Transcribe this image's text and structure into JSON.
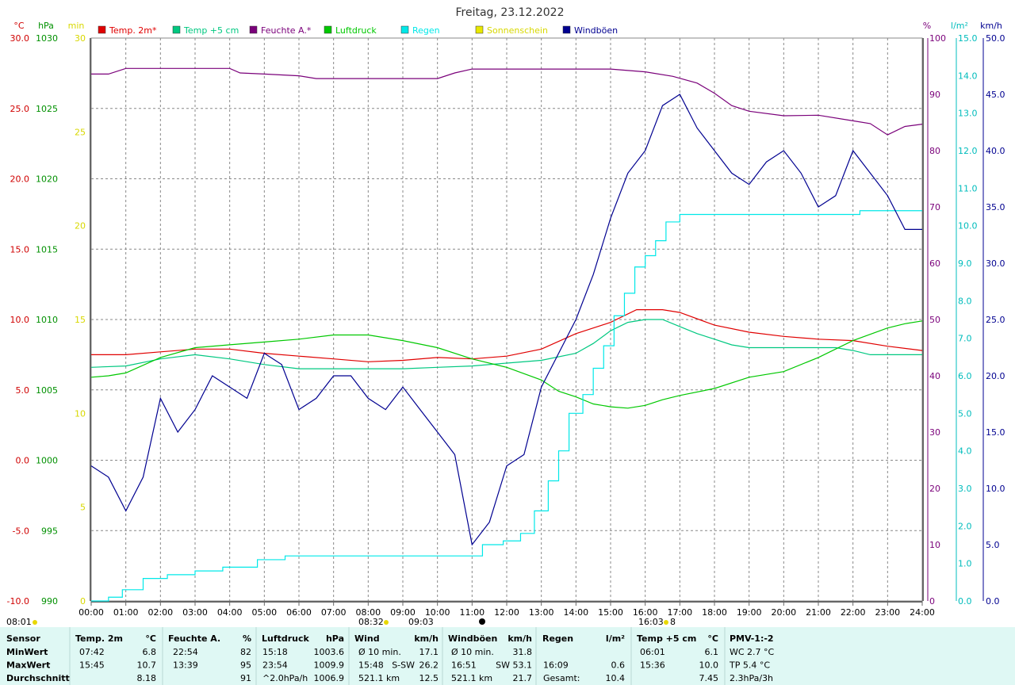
{
  "title": "Freitag, 23.12.2022",
  "legend": [
    {
      "label": "Temp. 2m*",
      "color": "#e00000"
    },
    {
      "label": "Temp +5 cm",
      "color": "#00c880"
    },
    {
      "label": "Feuchte A.*",
      "color": "#7a007a"
    },
    {
      "label": "Luftdruck",
      "color": "#00c800"
    },
    {
      "label": "Regen",
      "color": "#00e8e8"
    },
    {
      "label": "Sonnenschein",
      "color": "#e8e800"
    },
    {
      "label": "Windböen",
      "color": "#000090"
    }
  ],
  "axes": {
    "temp": {
      "unit": "°C",
      "ticks": [
        "30.0",
        "25.0",
        "20.0",
        "15.0",
        "10.0",
        "5.0",
        "0.0",
        "-5.0",
        "-10.0"
      ],
      "range": [
        -10,
        30
      ]
    },
    "pressure": {
      "unit": "hPa",
      "ticks": [
        "1030",
        "1025",
        "1020",
        "1015",
        "1010",
        "1005",
        "1000",
        "995",
        "990"
      ],
      "range": [
        990,
        1030
      ]
    },
    "sun": {
      "unit": "min",
      "ticks": [
        "30",
        "25",
        "20",
        "15",
        "10",
        "5",
        "0"
      ],
      "range": [
        0,
        30
      ]
    },
    "humidity": {
      "unit": "%",
      "ticks": [
        "100",
        "90",
        "80",
        "70",
        "60",
        "50",
        "40",
        "30",
        "20",
        "10",
        "0"
      ],
      "range": [
        0,
        100
      ]
    },
    "rain": {
      "unit": "l/m²",
      "ticks": [
        "15.0",
        "14.0",
        "13.0",
        "12.0",
        "11.0",
        "10.0",
        "9.0",
        "8.0",
        "7.0",
        "6.0",
        "5.0",
        "4.0",
        "3.0",
        "2.0",
        "1.0",
        "0.0"
      ],
      "range": [
        0,
        15
      ]
    },
    "wind": {
      "unit": "km/h",
      "ticks": [
        "50.0",
        "45.0",
        "40.0",
        "35.0",
        "30.0",
        "25.0",
        "20.0",
        "15.0",
        "10.0",
        "5.0",
        "0.0"
      ],
      "range": [
        0,
        50
      ]
    },
    "time": {
      "ticks": [
        "00:00",
        "01:00",
        "02:00",
        "03:00",
        "04:00",
        "05:00",
        "06:00",
        "07:00",
        "08:00",
        "09:00",
        "10:00",
        "11:00",
        "12:00",
        "13:00",
        "14:00",
        "15:00",
        "16:00",
        "17:00",
        "18:00",
        "19:00",
        "20:00",
        "21:00",
        "22:00",
        "23:00",
        "24:00"
      ]
    }
  },
  "markers": {
    "before_chart": "08:01",
    "sunrise": "08:32",
    "sunrise2": "09:03",
    "sunset": "16:03",
    "sunset2": "8"
  },
  "chart_data": {
    "type": "line",
    "x_unit": "hours",
    "series": [
      {
        "name": "Temp. 2m*",
        "axis": "temp",
        "color": "#e00000",
        "x": [
          0,
          1,
          2,
          3,
          4,
          5,
          6,
          7,
          8,
          9,
          10,
          11,
          12,
          13,
          14,
          15,
          15.75,
          16.5,
          17,
          18,
          19,
          20,
          21,
          22,
          23,
          24
        ],
        "y": [
          7.5,
          7.5,
          7.7,
          7.9,
          7.9,
          7.6,
          7.4,
          7.2,
          7.0,
          7.1,
          7.3,
          7.2,
          7.4,
          7.9,
          9.0,
          9.8,
          10.7,
          10.7,
          10.5,
          9.6,
          9.1,
          8.8,
          8.6,
          8.5,
          8.1,
          7.8
        ]
      },
      {
        "name": "Temp +5 cm",
        "axis": "temp",
        "color": "#00c880",
        "x": [
          0,
          1,
          2,
          3,
          4,
          5,
          6,
          7,
          8,
          9,
          10,
          11,
          12,
          13,
          14,
          14.5,
          15,
          15.5,
          16,
          16.5,
          17,
          17.5,
          18,
          18.5,
          19,
          19.5,
          20,
          20.5,
          21,
          21.5,
          22,
          22.5,
          23,
          23.5,
          24
        ],
        "y": [
          6.6,
          6.7,
          7.2,
          7.5,
          7.2,
          6.8,
          6.5,
          6.5,
          6.5,
          6.5,
          6.6,
          6.7,
          6.9,
          7.1,
          7.6,
          8.3,
          9.2,
          9.8,
          10.0,
          10.0,
          9.5,
          9.0,
          8.6,
          8.2,
          8.0,
          8.0,
          8.0,
          8.0,
          8.0,
          8.0,
          7.8,
          7.5,
          7.5,
          7.5,
          7.5
        ]
      },
      {
        "name": "Feuchte A.*",
        "axis": "humidity",
        "color": "#7a007a",
        "x": [
          0,
          0.5,
          1,
          2,
          3,
          4,
          4.3,
          5,
          6,
          6.5,
          7,
          8,
          9,
          10,
          10.5,
          11,
          12,
          13,
          14,
          15,
          16,
          16.8,
          17.5,
          18,
          18.5,
          19,
          20,
          21,
          22,
          22.5,
          23,
          23.5,
          24
        ],
        "y": [
          93.6,
          93.6,
          94.6,
          94.6,
          94.6,
          94.6,
          93.8,
          93.6,
          93.3,
          92.8,
          92.8,
          92.8,
          92.8,
          92.8,
          93.8,
          94.5,
          94.5,
          94.5,
          94.5,
          94.5,
          94.0,
          93.2,
          92.0,
          90.2,
          88.0,
          87.0,
          86.2,
          86.3,
          85.3,
          84.8,
          82.8,
          84.3,
          84.7
        ]
      },
      {
        "name": "Luftdruck",
        "axis": "pressure",
        "color": "#00c800",
        "x": [
          0,
          0.5,
          1,
          2,
          3,
          4,
          5,
          6,
          7,
          8,
          9,
          10,
          11,
          12,
          13,
          13.5,
          14,
          14.5,
          15,
          15.5,
          16,
          16.5,
          17,
          18,
          19,
          20,
          21,
          22,
          23,
          23.5,
          24
        ],
        "y": [
          1005.9,
          1006.0,
          1006.2,
          1007.3,
          1008.0,
          1008.2,
          1008.4,
          1008.6,
          1008.9,
          1008.9,
          1008.5,
          1008.0,
          1007.2,
          1006.6,
          1005.7,
          1004.9,
          1004.5,
          1004.0,
          1003.8,
          1003.7,
          1003.9,
          1004.3,
          1004.6,
          1005.1,
          1005.9,
          1006.3,
          1007.3,
          1008.5,
          1009.4,
          1009.7,
          1009.9
        ]
      },
      {
        "name": "Regen",
        "axis": "rain",
        "color": "#00e8e8",
        "x": [
          0,
          0.5,
          0.9,
          1.5,
          2.2,
          3.0,
          3.8,
          4.8,
          5.6,
          10.7,
          11.3,
          11.9,
          12.4,
          12.8,
          13.2,
          13.5,
          13.8,
          14.2,
          14.5,
          14.8,
          15.1,
          15.4,
          15.7,
          16.0,
          16.3,
          16.6,
          17.0,
          18.0,
          19.0,
          20.0,
          21.0,
          21.6,
          22.2,
          23.0,
          24.0
        ],
        "y": [
          0,
          0.1,
          0.3,
          0.6,
          0.7,
          0.8,
          0.9,
          1.1,
          1.2,
          1.2,
          1.5,
          1.6,
          1.8,
          2.4,
          3.2,
          4.0,
          5.0,
          5.5,
          6.2,
          6.8,
          7.6,
          8.2,
          8.9,
          9.2,
          9.6,
          10.1,
          10.3,
          10.3,
          10.3,
          10.3,
          10.3,
          10.3,
          10.4,
          10.4,
          10.4
        ]
      },
      {
        "name": "Windböen",
        "axis": "wind",
        "color": "#000090",
        "x": [
          0,
          0.5,
          1,
          1.5,
          2,
          2.5,
          3,
          3.5,
          4,
          4.5,
          5,
          5.5,
          6,
          6.5,
          7,
          7.5,
          8,
          8.5,
          9,
          9.5,
          10,
          10.5,
          11,
          11.5,
          12,
          12.5,
          13,
          13.5,
          14,
          14.5,
          15,
          15.5,
          16,
          16.5,
          17,
          17.5,
          18,
          18.5,
          19,
          19.5,
          20,
          20.5,
          21,
          21.5,
          22,
          22.5,
          23,
          23.5,
          24
        ],
        "y": [
          12,
          11,
          8,
          11,
          18,
          15,
          17,
          20,
          19,
          18,
          22,
          21,
          17,
          18,
          20,
          20,
          18,
          17,
          19,
          17,
          15,
          13,
          5,
          7,
          12,
          13,
          19,
          22,
          25,
          29,
          34,
          38,
          40,
          44,
          45,
          42,
          40,
          38,
          37,
          39,
          40,
          38,
          35,
          36,
          40,
          38,
          36,
          33,
          33
        ]
      }
    ],
    "xlim": [
      0,
      24
    ]
  },
  "summary": {
    "headers": {
      "sensor": "Sensor",
      "temp2m": "Temp. 2m",
      "temp2m_unit": "°C",
      "feuchte": "Feuchte A.",
      "feuchte_unit": "%",
      "luftdruck": "Luftdruck",
      "luftdruck_unit": "hPa",
      "wind": "Wind",
      "wind_unit": "km/h",
      "windboen": "Windböen",
      "windboen_unit": "km/h",
      "regen": "Regen",
      "regen_unit": "l/m²",
      "temp5": "Temp +5 cm",
      "temp5_unit": "°C",
      "pmv": "PMV-1:-2"
    },
    "rows": [
      {
        "label": "MinWert",
        "temp2m_time": "07:42",
        "temp2m_val": "6.8",
        "feuchte_time": "22:54",
        "feuchte_val": "82",
        "luftdruck_time": "15:18",
        "luftdruck_val": "1003.6",
        "wind_time": "Ø 10 min.",
        "wind_dir": "",
        "wind_val": "17.1",
        "windboen_time": "Ø 10 min.",
        "windboen_dir": "",
        "windboen_val": "31.8",
        "regen_time": "",
        "regen_val": "",
        "temp5_time": "06:01",
        "temp5_val": "6.1",
        "pmv": "WC 2.7 °C"
      },
      {
        "label": "MaxWert",
        "temp2m_time": "15:45",
        "temp2m_val": "10.7",
        "feuchte_time": "13:39",
        "feuchte_val": "95",
        "luftdruck_time": "23:54",
        "luftdruck_val": "1009.9",
        "wind_time": "15:48",
        "wind_dir": "S-SW",
        "wind_val": "26.2",
        "windboen_time": "16:51",
        "windboen_dir": "SW",
        "windboen_val": "53.1",
        "regen_time": "16:09",
        "regen_val": "0.6",
        "temp5_time": "15:36",
        "temp5_val": "10.0",
        "pmv": "TP 5.4 °C"
      },
      {
        "label": "Durchschnitt",
        "temp2m_time": "",
        "temp2m_val": "8.18",
        "feuchte_time": "",
        "feuchte_val": "91",
        "luftdruck_time": "^2.0hPa/h",
        "luftdruck_val": "1006.9",
        "wind_time": "521.1 km",
        "wind_dir": "",
        "wind_val": "12.5",
        "windboen_time": "521.1 km",
        "windboen_dir": "",
        "windboen_val": "21.7",
        "regen_time": "Gesamt:",
        "regen_val": "10.4",
        "temp5_time": "",
        "temp5_val": "7.45",
        "pmv": "2.3hPa/3h"
      }
    ]
  }
}
